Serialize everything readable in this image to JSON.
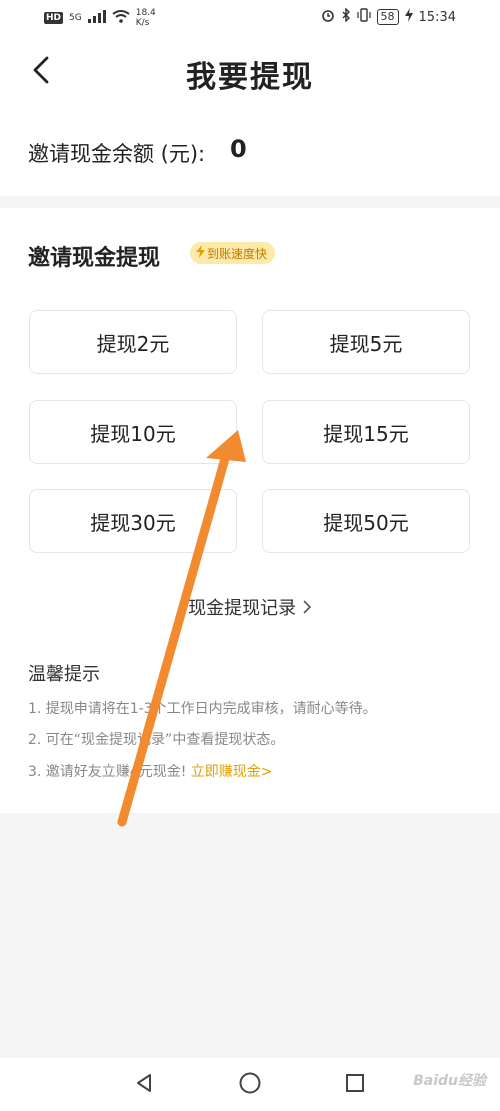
{
  "status_bar": {
    "hd": "HD",
    "network": "5G",
    "speed_value": "18.4",
    "speed_unit": "K/s",
    "battery": "58",
    "time": "15:34"
  },
  "header": {
    "title": "我要提现"
  },
  "balance": {
    "label": "邀请现金余额 (元):",
    "value": "0"
  },
  "withdraw": {
    "section_title": "邀请现金提现",
    "badge": "到账速度快",
    "options": [
      {
        "label": "提现2元"
      },
      {
        "label": "提现5元"
      },
      {
        "label": "提现10元"
      },
      {
        "label": "提现15元"
      },
      {
        "label": "提现30元"
      },
      {
        "label": "提现50元"
      }
    ],
    "record_link": "现金提现记录"
  },
  "tips": {
    "title": "温馨提示",
    "line1": "1. 提现申请将在1-3个工作日内完成审核，请耐心等待。",
    "line2": "2. 可在“现金提现记录”中查看提现状态。",
    "line3": "3. 邀请好友立赚4元现金!",
    "earn_link": "立即赚现金>"
  },
  "watermark": "Baidu经验",
  "colors": {
    "accent": "#e0a100",
    "badge_bg": "#fde9a8",
    "annotation_arrow": "#f28a30"
  }
}
